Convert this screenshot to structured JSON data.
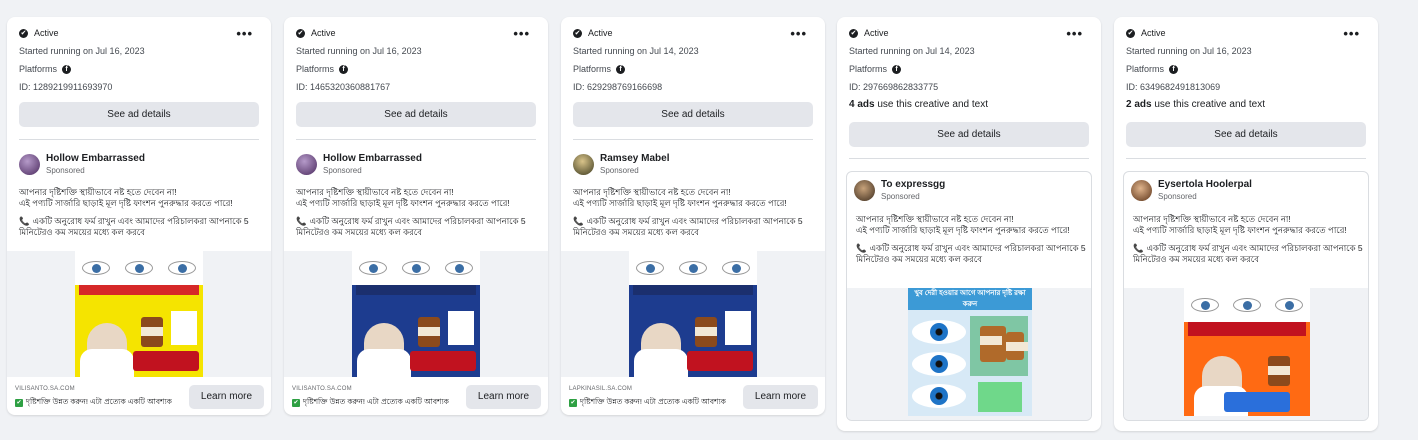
{
  "cards": [
    {
      "status": "Active",
      "started": "Started running on Jul 16, 2023",
      "platforms_label": "Platforms",
      "id_text": "ID: 1289219911693970",
      "uses_count": "",
      "uses_text": "",
      "see_details": "See ad details",
      "advertiser": "Hollow Embarrassed",
      "sponsored": "Sponsored",
      "body_line1": "আপনার দৃষ্টিশক্তি স্থায়ীভাবে নষ্ট হতে দেবেন না!",
      "body_line2": "এই পণ্যটি সার্জারি ছাড়াই মূল দৃষ্টি ফাংশন পুনরুদ্ধার করতে পারে!",
      "body_line3": "একটি অনুরোধ ফর্ম রাখুন এবং আমাদের পরিচালকরা আপনাকে 5 মিনিটেরও কম সময়ের মধ্যে কল করবে",
      "domain": "VILISANTO.SA.COM",
      "cta_text": "দৃষ্টিশক্তি উন্নত করুন! এটা প্রত্যেক একটি আবশ্যক",
      "learn_more": "Learn more",
      "creative_bg": "#f5e400"
    },
    {
      "status": "Active",
      "started": "Started running on Jul 16, 2023",
      "platforms_label": "Platforms",
      "id_text": "ID: 1465320360881767",
      "uses_count": "",
      "uses_text": "",
      "see_details": "See ad details",
      "advertiser": "Hollow Embarrassed",
      "sponsored": "Sponsored",
      "body_line1": "আপনার দৃষ্টিশক্তি স্থায়ীভাবে নষ্ট হতে দেবেন না!",
      "body_line2": "এই পণ্যটি সার্জারি ছাড়াই মূল দৃষ্টি ফাংশন পুনরুদ্ধার করতে পারে!",
      "body_line3": "একটি অনুরোধ ফর্ম রাখুন এবং আমাদের পরিচালকরা আপনাকে 5 মিনিটেরও কম সময়ের মধ্যে কল করবে",
      "domain": "VILISANTO.SA.COM",
      "cta_text": "দৃষ্টিশক্তি উন্নত করুন! এটা প্রত্যেক একটি আবশ্যক",
      "learn_more": "Learn more",
      "creative_bg": "#1d3c8f"
    },
    {
      "status": "Active",
      "started": "Started running on Jul 14, 2023",
      "platforms_label": "Platforms",
      "id_text": "ID: 629298769166698",
      "uses_count": "",
      "uses_text": "",
      "see_details": "See ad details",
      "advertiser": "Ramsey Mabel",
      "sponsored": "Sponsored",
      "body_line1": "আপনার দৃষ্টিশক্তি স্থায়ীভাবে নষ্ট হতে দেবেন না!",
      "body_line2": "এই পণ্যটি সার্জারি ছাড়াই মূল দৃষ্টি ফাংশন পুনরুদ্ধার করতে পারে!",
      "body_line3": "একটি অনুরোধ ফর্ম রাখুন এবং আমাদের পরিচালকরা আপনাকে 5 মিনিটেরও কম সময়ের মধ্যে কল করবে",
      "domain": "LAPKINASIL.SA.COM",
      "cta_text": "দৃষ্টিশক্তি উন্নত করুন! এটা প্রত্যেক একটি আবশ্যক",
      "learn_more": "Learn more",
      "creative_bg": "#1d3c8f"
    },
    {
      "status": "Active",
      "started": "Started running on Jul 14, 2023",
      "platforms_label": "Platforms",
      "id_text": "ID: 297669862833775",
      "uses_count": "4 ads",
      "uses_text": " use this creative and text",
      "see_details": "See ad details",
      "advertiser": "To expressgg",
      "sponsored": "Sponsored",
      "body_line1": "আপনার দৃষ্টিশক্তি স্থায়ীভাবে নষ্ট হতে দেবেন না!",
      "body_line2": "এই পণ্যটি সার্জারি ছাড়াই মূল দৃষ্টি ফাংশন পুনরুদ্ধার করতে পারে!",
      "body_line3": "একটি অনুরোধ ফর্ম রাখুন এবং আমাদের পরিচালকরা আপনাকে 5 মিনিটেরও কম সময়ের মধ্যে কল করবে",
      "creative_title": "খুব দেরী হওয়ার আগে আপনার দৃষ্টি রক্ষা করুন",
      "creative_bg": "#d7e9f6"
    },
    {
      "status": "Active",
      "started": "Started running on Jul 16, 2023",
      "platforms_label": "Platforms",
      "id_text": "ID: 6349682491813069",
      "uses_count": "2 ads",
      "uses_text": " use this creative and text",
      "see_details": "See ad details",
      "advertiser": "Eysertola Hoolerpal",
      "sponsored": "Sponsored",
      "body_line1": "আপনার দৃষ্টিশক্তি স্থায়ীভাবে নষ্ট হতে দেবেন না!",
      "body_line2": "এই পণ্যটি সার্জারি ছাড়াই মূল দৃষ্টি ফাংশন পুনরুদ্ধার করতে পারে!",
      "body_line3": "একটি অনুরোধ ফর্ম রাখুন এবং আমাদের পরিচালকরা আপনাকে 5 মিনিটেরও কম সময়ের মধ্যে কল করবে",
      "creative_bg": "#ff6a13"
    }
  ],
  "icons": {
    "check": "✔",
    "more": "•••",
    "facebook": "f",
    "phone": "📞",
    "green_check": "✔"
  }
}
